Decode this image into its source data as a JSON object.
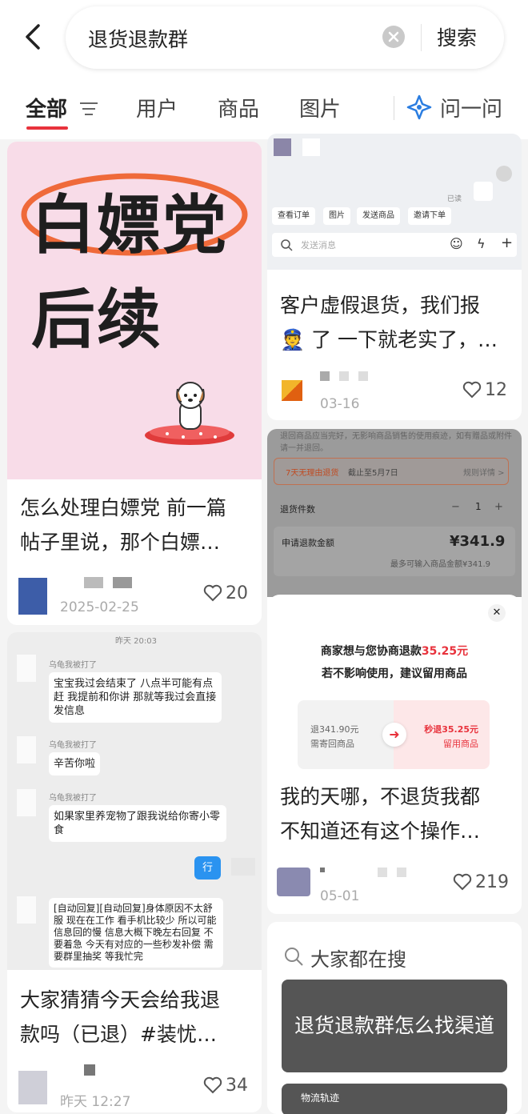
{
  "search": {
    "query": "退货退款群",
    "button_label": "搜索"
  },
  "tabs": [
    {
      "label": "全部"
    },
    {
      "label": "用户"
    },
    {
      "label": "商品"
    },
    {
      "label": "图片"
    }
  ],
  "ask_label": "问一问",
  "cards": [
    {
      "cover_line1": "白嫖党",
      "cover_line2": "后续",
      "title_line1": "怎么处理白嫖党 前一篇",
      "title_line2": "帖子里说，那个白嫖…",
      "date": "2025-02-25",
      "likes": "20"
    },
    {
      "chat_time": "昨天 20:03",
      "chat_name": "乌龟我被打了",
      "messages": [
        "宝宝我过会结束了 八点半可能有点赶 我提前和你讲 那就等我过会直接发信息",
        "辛苦你啦",
        "如果家里养宠物了跟我说给你寄小零食",
        "行",
        "[自动回复][自动回复]身体原因不太舒服 现在在工作 看手机比较少 所以可能信息回的慢 信息大概下晚左右回复 不要着急 今天有对应的一些秒发补偿 需要群里抽奖 等我忙完"
      ],
      "title_line1": "大家猜猜今天会给我退",
      "title_line2": "款吗（已退）#装忧…",
      "date": "昨天 12:27",
      "likes": "34"
    },
    {
      "chips": [
        "查看订单",
        "图片",
        "发送商品",
        "邀请下单"
      ],
      "read_label": "已读",
      "input_placeholder": "发送消息",
      "title_line1": "客户虚假退货，我们报",
      "title_line2": "👮 了 一下就老实了，…",
      "date": "03-16",
      "likes": "12"
    },
    {
      "refund_note": "退回商品应当完好，无影响商品销售的使用痕迹，如有赠品或附件请一并退回。",
      "refund_badge": "7天无理由退货",
      "refund_deadline": "截止至5月7日",
      "refund_rule": "规则详情 >",
      "refund_qty_label": "退货件数",
      "refund_qty": "1",
      "refund_amount_label": "申请退款金额",
      "refund_amount": "¥341.9",
      "refund_max": "最多可输入商品金额¥341.9",
      "popup_line1": "商家想与您协商退款",
      "popup_amount": "35.25元",
      "popup_line2": "若不影响使用，建议留用商品",
      "option_left_1": "退341.90元",
      "option_left_2": "需寄回商品",
      "option_right_1": "秒退35.25元",
      "option_right_2": "留用商品",
      "title_line1": "我的天哪，不退货我都",
      "title_line2": "不知道还有这个操作…",
      "date": "05-01",
      "likes": "219"
    }
  ],
  "trending": {
    "label": "大家都在搜",
    "items": [
      "退货退款群怎么找渠道",
      "物流轨迹"
    ]
  },
  "colors": {
    "accent": "#e8323c",
    "ask_icon": "#2a7de1"
  }
}
